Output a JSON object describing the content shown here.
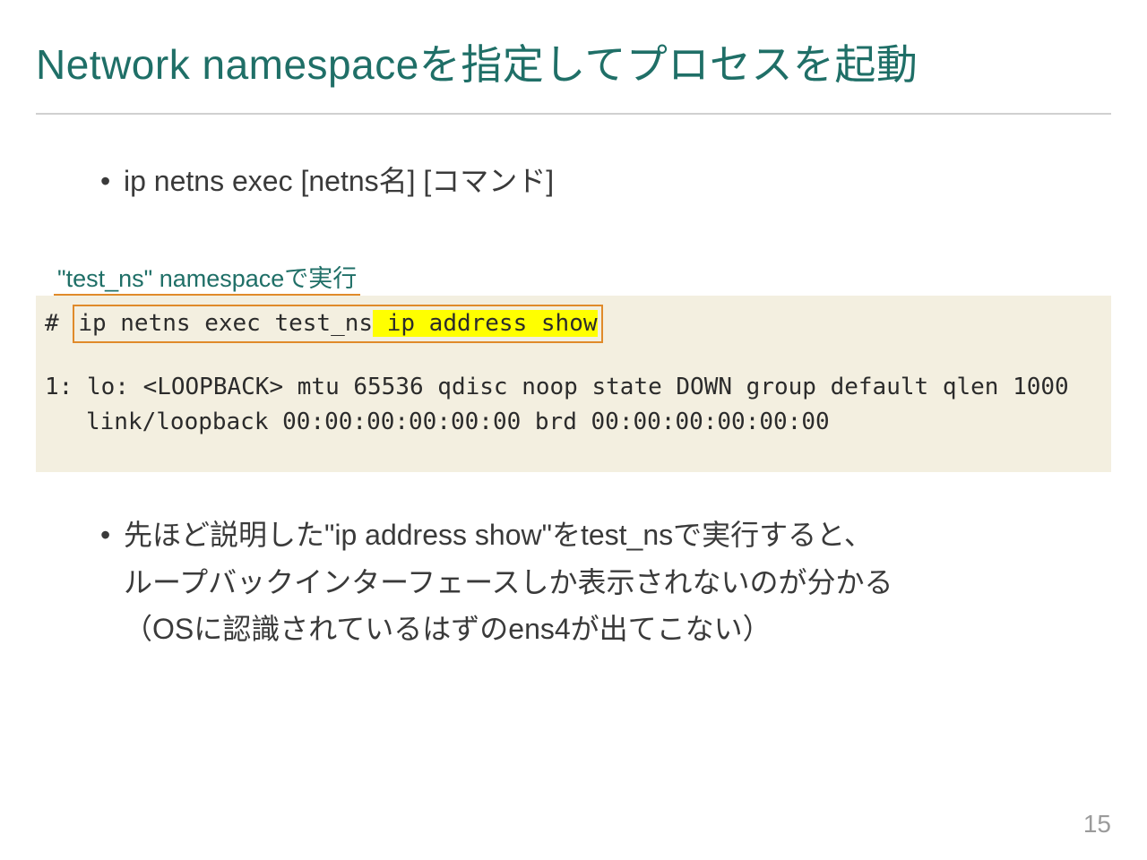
{
  "title": "Network namespaceを指定してプロセスを起動",
  "bullet1": "ip netns exec [netns名] [コマンド]",
  "annotation": "\"test_ns\" namespaceで実行",
  "code": {
    "prompt": "# ",
    "boxed_cmd": "ip netns exec test_ns",
    "highlighted_cmd": " ip address show",
    "output_line1": "1: lo: <LOOPBACK> mtu 65536 qdisc noop state DOWN group default qlen 1000",
    "output_line2": "link/loopback 00:00:00:00:00:00 brd 00:00:00:00:00:00"
  },
  "bullet2_l1": "先ほど説明した\"ip address show\"をtest_nsで実行すると、",
  "bullet2_l2": "ループバックインターフェースしか表示されないのが分かる",
  "bullet2_l3": "（OSに認識されているはずのens4が出てこない）",
  "page_number": "15"
}
